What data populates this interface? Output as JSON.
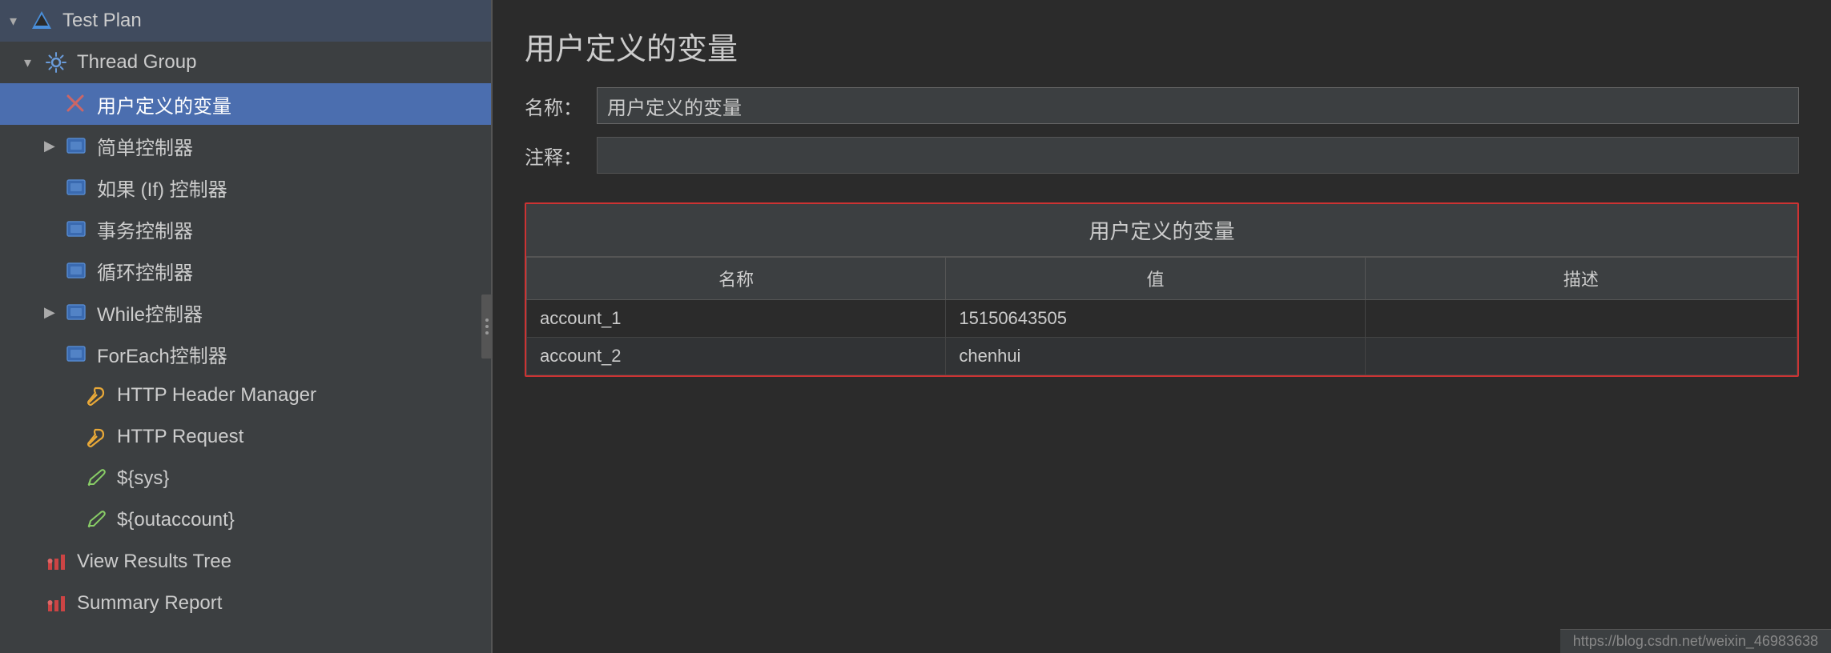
{
  "sidebar": {
    "items": [
      {
        "id": "test-plan",
        "label": "Test Plan",
        "icon": "triangle",
        "indent": 0,
        "arrow": "▾",
        "selected": false
      },
      {
        "id": "thread-group",
        "label": "Thread Group",
        "icon": "gear",
        "indent": 1,
        "arrow": "▾",
        "selected": false
      },
      {
        "id": "user-vars",
        "label": "用户定义的变量",
        "icon": "scissors",
        "indent": 2,
        "arrow": "",
        "selected": true
      },
      {
        "id": "simple-controller",
        "label": "简单控制器",
        "icon": "blue-rect",
        "indent": 2,
        "arrow": "▶",
        "selected": false
      },
      {
        "id": "if-controller",
        "label": "如果 (If) 控制器",
        "icon": "blue-rect",
        "indent": 2,
        "arrow": "",
        "selected": false
      },
      {
        "id": "transaction-controller",
        "label": "事务控制器",
        "icon": "blue-rect",
        "indent": 2,
        "arrow": "",
        "selected": false
      },
      {
        "id": "loop-controller",
        "label": "循环控制器",
        "icon": "blue-rect",
        "indent": 2,
        "arrow": "",
        "selected": false
      },
      {
        "id": "while-controller",
        "label": "While控制器",
        "icon": "blue-rect",
        "indent": 2,
        "arrow": "▶",
        "selected": false
      },
      {
        "id": "foreach-controller",
        "label": "ForEach控制器",
        "icon": "blue-rect",
        "indent": 2,
        "arrow": "",
        "selected": false
      },
      {
        "id": "http-header-manager",
        "label": "HTTP Header Manager",
        "icon": "wrench",
        "indent": 3,
        "arrow": "",
        "selected": false
      },
      {
        "id": "http-request",
        "label": "HTTP Request",
        "icon": "wrench",
        "indent": 3,
        "arrow": "",
        "selected": false
      },
      {
        "id": "sys-var",
        "label": "${sys}",
        "icon": "pencil",
        "indent": 3,
        "arrow": "",
        "selected": false
      },
      {
        "id": "outaccount-var",
        "label": "${outaccount}",
        "icon": "pencil",
        "indent": 3,
        "arrow": "",
        "selected": false
      },
      {
        "id": "view-results-tree",
        "label": "View Results Tree",
        "icon": "chart",
        "indent": 1,
        "arrow": "",
        "selected": false
      },
      {
        "id": "summary-report",
        "label": "Summary Report",
        "icon": "chart",
        "indent": 1,
        "arrow": "",
        "selected": false
      }
    ]
  },
  "main": {
    "page_title": "用户定义的变量",
    "name_label": "名称：",
    "name_value": "用户定义的变量",
    "comment_label": "注释：",
    "comment_value": "",
    "table_title": "用户定义的变量",
    "table_headers": [
      "名称",
      "值",
      "描述"
    ],
    "table_rows": [
      {
        "name": "account_1",
        "value": "15150643505",
        "desc": ""
      },
      {
        "name": "account_2",
        "value": "chenhui",
        "desc": ""
      }
    ]
  },
  "status_bar": {
    "url": "https://blog.csdn.net/weixin_46983638"
  }
}
